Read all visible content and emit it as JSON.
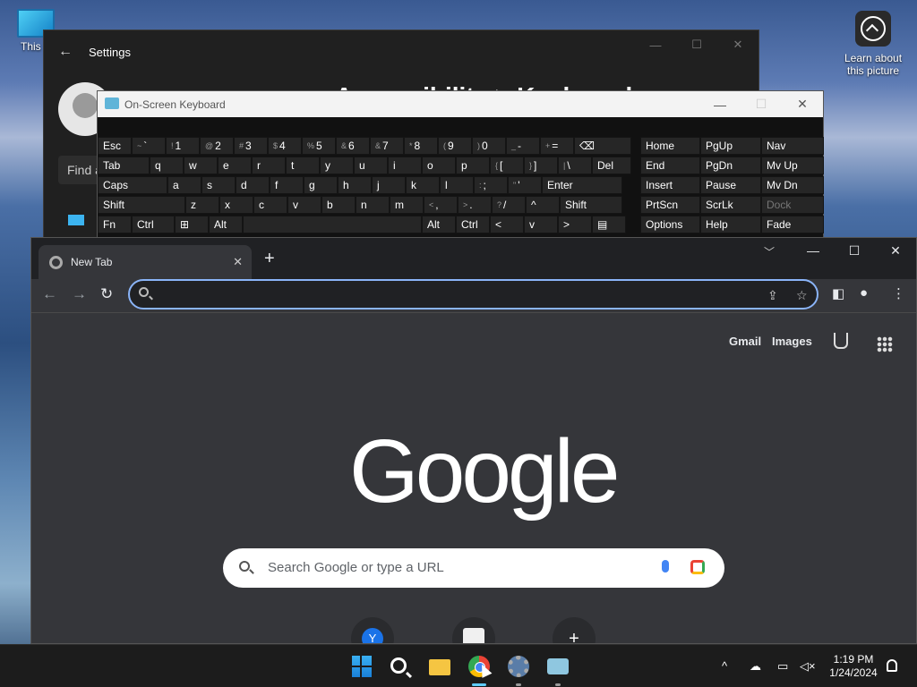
{
  "desktop": {
    "this_pc_label": "This P",
    "learn_label": "Learn about this picture"
  },
  "settings": {
    "title": "Settings",
    "heading": "Accessibility > Keyboard",
    "find_placeholder": "Find a"
  },
  "osk": {
    "title": "On-Screen Keyboard",
    "row1": [
      {
        "label": "Esc"
      },
      {
        "sub": "~",
        "label": "`"
      },
      {
        "sub": "!",
        "label": "1"
      },
      {
        "sub": "@",
        "label": "2"
      },
      {
        "sub": "#",
        "label": "3"
      },
      {
        "sub": "$",
        "label": "4"
      },
      {
        "sub": "%",
        "label": "5"
      },
      {
        "sub": "&",
        "label": "6"
      },
      {
        "sub": "&",
        "label": "7"
      },
      {
        "sub": "*",
        "label": "8"
      },
      {
        "sub": "(",
        "label": "9"
      },
      {
        "sub": ")",
        "label": "0"
      },
      {
        "sub": "_",
        "label": "-"
      },
      {
        "sub": "+",
        "label": "="
      },
      {
        "label": "⌫"
      }
    ],
    "row2": [
      {
        "label": "Tab"
      },
      {
        "label": "q"
      },
      {
        "label": "w"
      },
      {
        "label": "e"
      },
      {
        "label": "r"
      },
      {
        "label": "t"
      },
      {
        "label": "y"
      },
      {
        "label": "u"
      },
      {
        "label": "i"
      },
      {
        "label": "o"
      },
      {
        "label": "p"
      },
      {
        "sub": "{",
        "label": "["
      },
      {
        "sub": "}",
        "label": "]"
      },
      {
        "sub": "|",
        "label": "\\"
      },
      {
        "label": "Del"
      }
    ],
    "row3": [
      {
        "label": "Caps"
      },
      {
        "label": "a"
      },
      {
        "label": "s"
      },
      {
        "label": "d"
      },
      {
        "label": "f"
      },
      {
        "label": "g"
      },
      {
        "label": "h"
      },
      {
        "label": "j"
      },
      {
        "label": "k"
      },
      {
        "label": "l"
      },
      {
        "sub": ":",
        "label": ";"
      },
      {
        "sub": "\"",
        "label": "'"
      },
      {
        "label": "Enter"
      }
    ],
    "row4": [
      {
        "label": "Shift"
      },
      {
        "label": "z"
      },
      {
        "label": "x"
      },
      {
        "label": "c"
      },
      {
        "label": "v"
      },
      {
        "label": "b"
      },
      {
        "label": "n"
      },
      {
        "label": "m"
      },
      {
        "sub": "<",
        "label": ","
      },
      {
        "sub": ">",
        "label": "."
      },
      {
        "sub": "?",
        "label": "/"
      },
      {
        "label": "^"
      },
      {
        "label": "Shift"
      }
    ],
    "row5": [
      {
        "label": "Fn"
      },
      {
        "label": "Ctrl"
      },
      {
        "label": "⊞"
      },
      {
        "label": "Alt"
      },
      {
        "label": ""
      },
      {
        "label": "Alt"
      },
      {
        "label": "Ctrl"
      },
      {
        "label": "<"
      },
      {
        "label": "v"
      },
      {
        "label": ">"
      },
      {
        "label": "▤"
      }
    ],
    "nav_keys": [
      [
        "Home",
        "PgUp",
        "Nav"
      ],
      [
        "End",
        "PgDn",
        "Mv Up"
      ],
      [
        "Insert",
        "Pause",
        "Mv Dn"
      ],
      [
        "PrtScn",
        "ScrLk",
        "Dock"
      ],
      [
        "Options",
        "Help",
        "Fade"
      ]
    ]
  },
  "chrome": {
    "tab_title": "New Tab",
    "gmail": "Gmail",
    "images": "Images",
    "logo": "Google",
    "search_placeholder": "Search Google or type a URL",
    "shortcut_y": "Y",
    "shortcut_add": "+"
  },
  "taskbar": {
    "time": "1:19 PM",
    "date": "1/24/2024",
    "accent": "#60cdff"
  }
}
